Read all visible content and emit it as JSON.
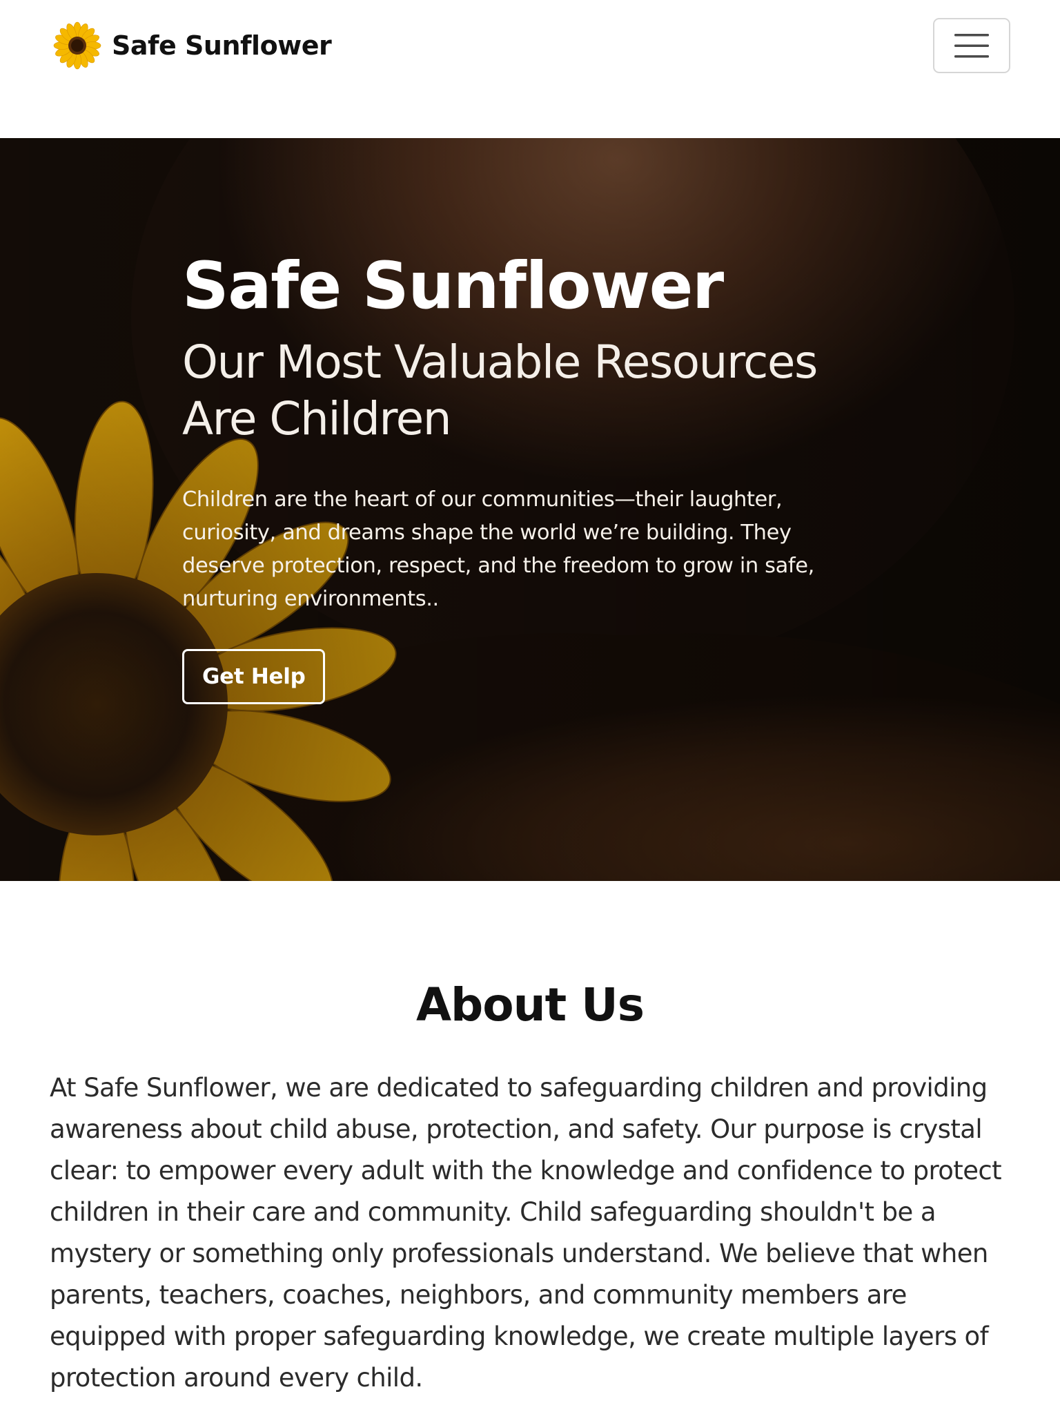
{
  "navbar": {
    "brand_name": "Safe Sunflower",
    "logo_icon": "sunflower-icon",
    "toggler_icon": "hamburger-menu-icon"
  },
  "hero": {
    "title": "Safe Sunflower",
    "subtitle": "Our Most Valuable Resources Are Children",
    "text": "Children are the heart of our communities—their laughter, curiosity, and dreams shape the world we’re building. They deserve protection, respect, and the freedom to grow in safe, nurturing environments..",
    "button_label": "Get Help",
    "image_description_icon": "child-with-sunflower-photo"
  },
  "about": {
    "title": "About Us",
    "text": "At Safe Sunflower, we are dedicated to safeguarding children and providing awareness about child abuse, protection, and safety. Our purpose is crystal clear: to empower every adult with the knowledge and confidence to protect children in their care and community. Child safeguarding shouldn't be a mystery or something only professionals understand. We believe that when parents, teachers, coaches, neighbors, and community members are equipped with proper safeguarding knowledge, we create multiple layers of protection around every child."
  },
  "colors": {
    "accent_sunflower": "#f2b705",
    "hero_overlay": "#160e08",
    "text_dark": "#111111"
  }
}
